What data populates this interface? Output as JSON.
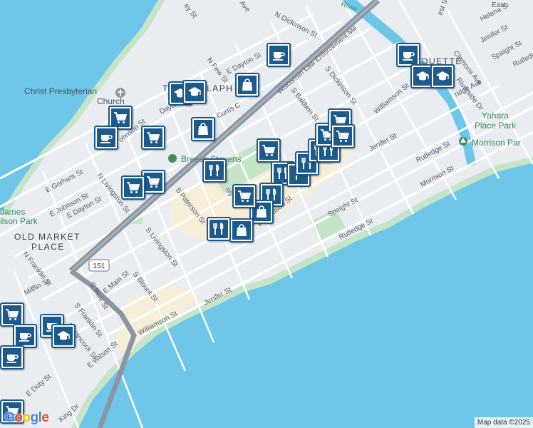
{
  "map": {
    "streets": {
      "n_dickinson": "N Dickinson St",
      "wisconsin_law": "Wisconsin Law Enforcement Me",
      "n_few": "N Few St",
      "e_dayton_top": "E Dayton St",
      "curtis": "Curtis C",
      "s_dickinson": "S Dickinson St",
      "s_baldwin": "S Baldwin St",
      "williamson_upper": "Williamson St",
      "jenifer_upper": "Jenifer St",
      "rutledge_upper": "Rutledge St",
      "morrison": "Morrison St",
      "spaight_upper": "Spaight St",
      "rutledge_mid": "Rutledge St",
      "e_gorham": "E Gorham St",
      "e_johnson": "E Johnson St",
      "e_johnson_lower": "E Johnson St",
      "n_livingston": "N Livingston St",
      "e_dayton": "E Dayton St",
      "s_paterson": "S Paterson St",
      "s_livingston": "S Livingston St",
      "williamson": "Williamson St",
      "e_main": "E Main St",
      "s_blount": "S Blount St",
      "jenifer": "Jenifer St",
      "williamson_lower": "Williamson St",
      "e_mifflin": "Mifflin St",
      "n_franklin": "N Franklin St",
      "s_franklin": "S Franklin St",
      "s_blair": "S Blair St",
      "s_hancock": "S Hancock St",
      "e_wilson": "E Wilson St",
      "e_doty": "E Doty St",
      "king": "King Dr",
      "e_johnson_short": "ohnson St",
      "dayton_mid": "Dayton St",
      "nly": "nly St",
      "first": "irst St",
      "east": "East",
      "helena": "Helena St",
      "jenifer_ne": "Jenifer St",
      "spaight_ne": "Spaight St",
      "rutledge_ne": "Rutledge St",
      "clemons": "Clemons Ave",
      "riverside": "Riverside Dr",
      "ridge": "ridge Ave",
      "ey": "ey St",
      "ave": "Ave",
      "river": "River"
    },
    "places": {
      "church": "Christ Presbyterian Church",
      "church_l1": "Christ Presbyterian",
      "church_l2": "Church",
      "breese": "Breese Stevens",
      "yahara_park": "Yahara Place Park",
      "yahara_l1": "Yahara",
      "yahara_l2": "Place Park",
      "morrison_park": "Morrison Par",
      "james_park_l1": "James",
      "james_park_l2": "ilson Park"
    },
    "neighborhoods": {
      "old_market_l1": "OLD MARKET",
      "old_market_l2": "PLACE",
      "tenney": "TENNEY-LAPH",
      "marquette": "MARQUETTE"
    },
    "highway": "151",
    "google_logo": [
      "G",
      "o",
      "o",
      "g",
      "l",
      "e"
    ],
    "google_colors": [
      "#4285F4",
      "#EA4335",
      "#FBBC05",
      "#4285F4",
      "#34A853",
      "#EA4335"
    ],
    "attribution": "Map data ©2025",
    "colors": {
      "water": "#6ec6e8",
      "land": "#e9edf1",
      "road": "#ffffff",
      "highway": "#8b95a3",
      "park": "#c6e4c8",
      "commercial": "#f6eed8",
      "pin_border": "#1d5a8c"
    },
    "pins": [
      {
        "type": "coffee"
      },
      {
        "type": "education"
      },
      {
        "type": "education"
      },
      {
        "type": "shopping"
      },
      {
        "type": "grocery"
      },
      {
        "type": "coffee"
      },
      {
        "type": "grocery"
      },
      {
        "type": "shopping"
      },
      {
        "type": "coffee"
      },
      {
        "type": "education"
      },
      {
        "type": "education"
      },
      {
        "type": "grocery"
      },
      {
        "type": "restaurant"
      },
      {
        "type": "grocery"
      },
      {
        "type": "grocery"
      },
      {
        "type": "restaurant"
      },
      {
        "type": "parking"
      },
      {
        "type": "restaurant"
      },
      {
        "type": "restaurant"
      },
      {
        "type": "restaurant"
      },
      {
        "type": "grocery"
      },
      {
        "type": "grocery"
      },
      {
        "type": "grocery"
      },
      {
        "type": "restaurant"
      },
      {
        "type": "shopping"
      },
      {
        "type": "grocery"
      },
      {
        "type": "restaurant"
      },
      {
        "type": "shopping"
      },
      {
        "type": "grocery"
      },
      {
        "type": "coffee"
      },
      {
        "type": "coffee"
      },
      {
        "type": "education"
      },
      {
        "type": "coffee"
      },
      {
        "type": "grocery"
      }
    ]
  }
}
